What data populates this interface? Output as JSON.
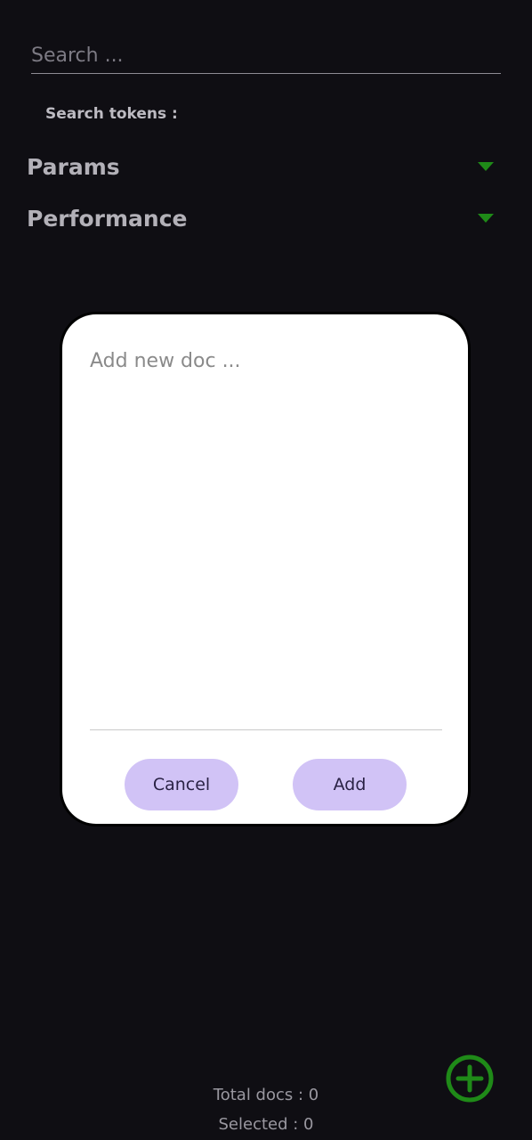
{
  "search": {
    "placeholder": "Search ..."
  },
  "search_tokens_label": "Search tokens :",
  "sections": [
    {
      "title": "Params",
      "icon": "chevron-down-icon"
    },
    {
      "title": "Performance",
      "icon": "chevron-down-icon"
    }
  ],
  "dialog": {
    "input_placeholder": "Add new doc ...",
    "cancel_label": "Cancel",
    "add_label": "Add"
  },
  "footer": {
    "total_docs": "Total docs : 0",
    "selected": "Selected : 0"
  },
  "fab": {
    "icon": "add-circle-icon"
  },
  "colors": {
    "background": "#0f0e13",
    "accent_green": "#1f8a18",
    "button_bg": "#d1c3f6"
  }
}
